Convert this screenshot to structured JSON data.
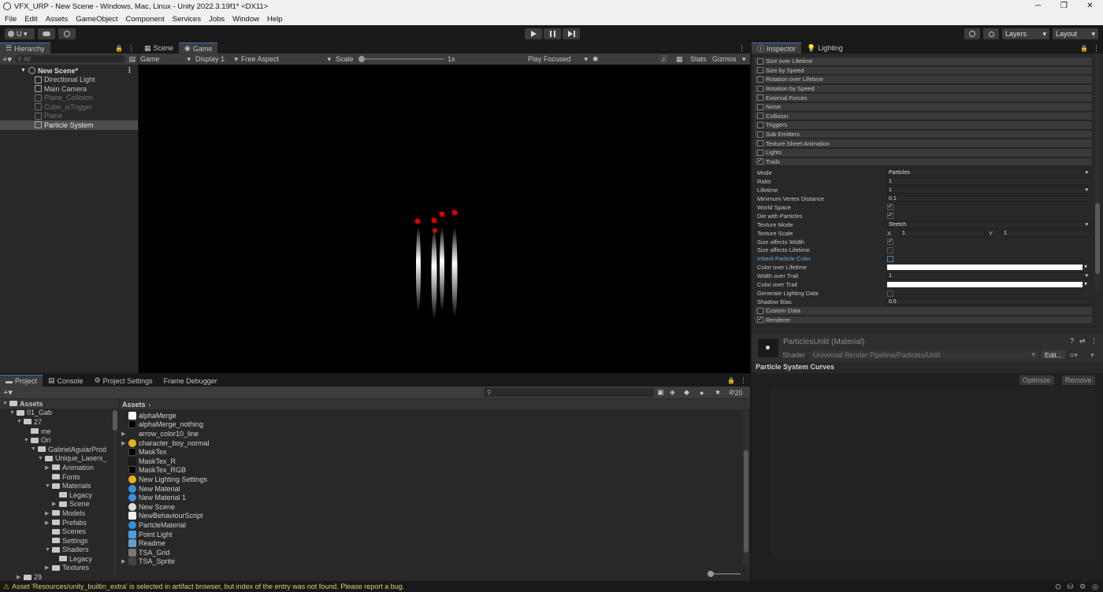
{
  "window": {
    "title": "VFX_URP - New Scene - Windows, Mac, Linux - Unity 2022.3.19f1* <DX11>",
    "controls": [
      "─",
      "❐",
      "✕"
    ]
  },
  "menu": [
    "File",
    "Edit",
    "Assets",
    "GameObject",
    "Component",
    "Services",
    "Jobs",
    "Window",
    "Help"
  ],
  "toolbar": {
    "account_label": "U ▾",
    "layers_label": "Layers",
    "layout_label": "Layout"
  },
  "hierarchy": {
    "tab_label": "Hierarchy",
    "search_placeholder": "All",
    "scene_name": "New Scene*",
    "items": [
      {
        "label": "Directional Light"
      },
      {
        "label": "Main Camera"
      },
      {
        "label": "Plane_Collision"
      },
      {
        "label": "Cube_isTrigger"
      },
      {
        "label": "Plane"
      },
      {
        "label": "Particle System"
      }
    ]
  },
  "game_view": {
    "tabs": [
      "Scene",
      "Game"
    ],
    "mode": "Game",
    "display": "Display 1",
    "aspect": "Free Aspect",
    "scale_label": "Scale",
    "scale_value": "1x",
    "play_focused": "Play Focused",
    "stats": "Stats",
    "gizmos": "Gizmos"
  },
  "inspector": {
    "tabs": [
      "Inspector",
      "Lighting"
    ],
    "modules": [
      {
        "label": "Size over Lifetime",
        "checked": false
      },
      {
        "label": "Size by Speed",
        "checked": false
      },
      {
        "label": "Rotation over Lifetime",
        "checked": false
      },
      {
        "label": "Rotation by Speed",
        "checked": false
      },
      {
        "label": "External Forces",
        "checked": false
      },
      {
        "label": "Noise",
        "checked": false
      },
      {
        "label": "Collision",
        "checked": false
      },
      {
        "label": "Triggers",
        "checked": false
      },
      {
        "label": "Sub Emitters",
        "checked": false
      },
      {
        "label": "Texture Sheet Animation",
        "checked": false
      },
      {
        "label": "Lights",
        "checked": false
      },
      {
        "label": "Trails",
        "checked": true
      }
    ],
    "trail_props": [
      {
        "label": "Mode",
        "value": "Particles",
        "kind": "dropdown"
      },
      {
        "label": "Ratio",
        "value": "1",
        "kind": "field"
      },
      {
        "label": "Lifetime",
        "value": "1",
        "kind": "dropdown"
      },
      {
        "label": "Minimum Vertex Distance",
        "value": "0.1",
        "kind": "field"
      },
      {
        "label": "World Space",
        "value": "✓",
        "kind": "check"
      },
      {
        "label": "Die with Particles",
        "value": "✓",
        "kind": "check"
      },
      {
        "label": "Texture Mode",
        "value": "Stretch",
        "kind": "dropdown"
      },
      {
        "label": "Texture Scale",
        "value": "",
        "kind": "xy"
      },
      {
        "label": "Size affects Width",
        "value": "✓",
        "kind": "check"
      },
      {
        "label": "Size affects Lifetime",
        "value": "",
        "kind": "check"
      },
      {
        "label": "Inherit Particle Color",
        "value": "",
        "kind": "check"
      },
      {
        "label": "Color over Lifetime",
        "value": "",
        "kind": "color"
      },
      {
        "label": "Width over Trail",
        "value": "1",
        "kind": "dropdown"
      },
      {
        "label": "Color over Trail",
        "value": "",
        "kind": "color"
      },
      {
        "label": "Generate Lighting Data",
        "value": "",
        "kind": "check"
      },
      {
        "label": "Shadow Bias",
        "value": "0.5",
        "kind": "field"
      }
    ],
    "texture_scale": {
      "x_label": "X",
      "x": "1",
      "y_label": "Y",
      "y": "1"
    },
    "end_modules": [
      {
        "label": "Custom Data",
        "checked": false
      },
      {
        "label": "Renderer",
        "checked": true
      }
    ],
    "material": {
      "name": "ParticlesUnlit (Material)",
      "shader_label": "Shader",
      "shader": "Universal Render Pipeline/Particles/Unlit",
      "edit": "Edit..."
    },
    "curves_title": "Particle System Curves",
    "optimize": "Optimize",
    "remove": "Remove"
  },
  "project": {
    "tabs": [
      "Project",
      "Console",
      "Project Settings",
      "Frame Debugger"
    ],
    "hidden_count": "20",
    "tree": [
      {
        "label": "Assets",
        "depth": 0
      },
      {
        "label": "01_Gab",
        "depth": 1
      },
      {
        "label": "27",
        "depth": 2
      },
      {
        "label": "me",
        "depth": 3
      },
      {
        "label": "Ori",
        "depth": 3
      },
      {
        "label": "GabrielAguiarProd",
        "depth": 4
      },
      {
        "label": "Unique_Lasers_",
        "depth": 5
      },
      {
        "label": "Animation",
        "depth": 6
      },
      {
        "label": "Fonts",
        "depth": 6
      },
      {
        "label": "Materials",
        "depth": 6
      },
      {
        "label": "Legacy",
        "depth": 7
      },
      {
        "label": "Scene",
        "depth": 7
      },
      {
        "label": "Models",
        "depth": 6
      },
      {
        "label": "Prefabs",
        "depth": 6
      },
      {
        "label": "Scenes",
        "depth": 6
      },
      {
        "label": "Settings",
        "depth": 6
      },
      {
        "label": "Shaders",
        "depth": 6
      },
      {
        "label": "Legacy",
        "depth": 7
      },
      {
        "label": "Textures",
        "depth": 6
      },
      {
        "label": "29",
        "depth": 2
      }
    ],
    "breadcrumb": "Assets",
    "assets": [
      {
        "label": "alphaMerge",
        "icon": "white"
      },
      {
        "label": "alphaMerge_nothing",
        "icon": "dot"
      },
      {
        "label": "arrow_color10_line",
        "icon": "arrow"
      },
      {
        "label": "character_boy_normal",
        "icon": "bulb"
      },
      {
        "label": "MaskTex",
        "icon": "dot"
      },
      {
        "label": "MaskTex_R",
        "icon": "red"
      },
      {
        "label": "MaskTex_RGB",
        "icon": "dot"
      },
      {
        "label": "New Lighting Settings",
        "icon": "bulb"
      },
      {
        "label": "New Material",
        "icon": "sphere"
      },
      {
        "label": "New Material 1",
        "icon": "sphere"
      },
      {
        "label": "New Scene",
        "icon": "unity"
      },
      {
        "label": "NewBehaviourScript",
        "icon": "script"
      },
      {
        "label": "PartcleMaterial",
        "icon": "sphere"
      },
      {
        "label": "Point Light",
        "icon": "cube"
      },
      {
        "label": "Readme",
        "icon": "readme"
      },
      {
        "label": "TSA_Grid",
        "icon": "grid"
      },
      {
        "label": "TSA_Sprite",
        "icon": "sprite"
      }
    ]
  },
  "status_bar": {
    "message": "Asset 'Resources/unity_builtin_extra' is selected in artifact browser, but index of the entry was not found. Please report a bug."
  }
}
